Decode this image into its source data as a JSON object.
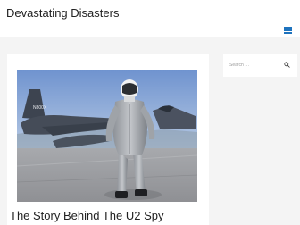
{
  "header": {
    "site_title": "Devastating Disasters",
    "menu_icon": "hamburger-menu-icon"
  },
  "article": {
    "title": "The Story Behind The U2 Spy",
    "image_alt": "Pilot in a flight suit standing in front of a U2 spy plane",
    "plane_marking": "N800X"
  },
  "sidebar": {
    "search_placeholder": "Search …",
    "search_icon": "search-icon"
  },
  "colors": {
    "accent": "#1e73be",
    "page_bg": "#f4f4f4",
    "card_bg": "#ffffff"
  }
}
